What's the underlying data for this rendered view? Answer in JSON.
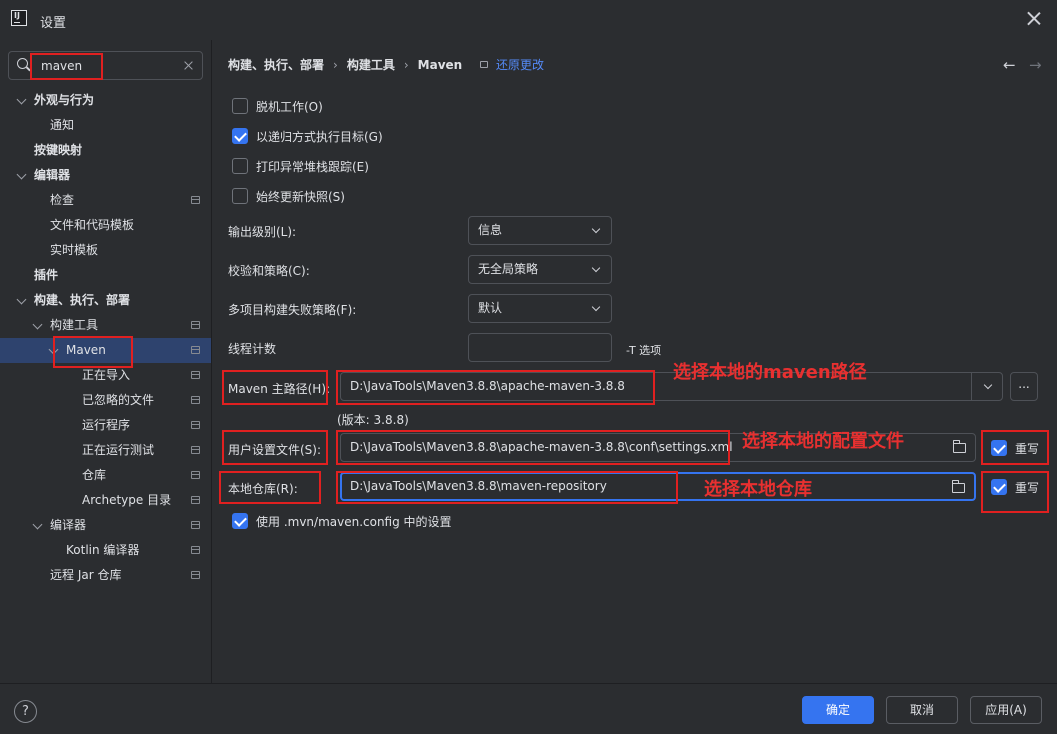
{
  "window": {
    "title": "设置"
  },
  "search": {
    "value": "maven",
    "placeholder": ""
  },
  "sidebar": {
    "items": [
      {
        "label": "外观与行为",
        "level": 0,
        "expanded": true,
        "bold": true
      },
      {
        "label": "通知",
        "level": 1
      },
      {
        "label": "按键映射",
        "level": 0,
        "bold": true
      },
      {
        "label": "编辑器",
        "level": 0,
        "expanded": true,
        "bold": true
      },
      {
        "label": "检查",
        "level": 1,
        "project_icon": true
      },
      {
        "label": "文件和代码模板",
        "level": 1
      },
      {
        "label": "实时模板",
        "level": 1
      },
      {
        "label": "插件",
        "level": 0,
        "bold": true
      },
      {
        "label": "构建、执行、部署",
        "level": 0,
        "expanded": true,
        "bold": true
      },
      {
        "label": "构建工具",
        "level": 1,
        "expanded": true,
        "project_icon": true
      },
      {
        "label": "Maven",
        "level": 2,
        "expanded": true,
        "selected": true,
        "project_icon": true
      },
      {
        "label": "正在导入",
        "level": 3,
        "project_icon": true
      },
      {
        "label": "已忽略的文件",
        "level": 3,
        "project_icon": true
      },
      {
        "label": "运行程序",
        "level": 3,
        "project_icon": true
      },
      {
        "label": "正在运行测试",
        "level": 3,
        "project_icon": true
      },
      {
        "label": "仓库",
        "level": 3,
        "project_icon": true
      },
      {
        "label": "Archetype 目录",
        "level": 3,
        "project_icon": true
      },
      {
        "label": "编译器",
        "level": 1,
        "expanded": true,
        "project_icon": true
      },
      {
        "label": "Kotlin 编译器",
        "level": 2,
        "project_icon": true
      },
      {
        "label": "远程 Jar 仓库",
        "level": 1,
        "project_icon": true
      }
    ]
  },
  "breadcrumb": {
    "part1": "构建、执行、部署",
    "part2": "构建工具",
    "part3": "Maven",
    "separator": "›"
  },
  "revert_label": "还原更改",
  "nav": {
    "back": "←",
    "forward": "→"
  },
  "options": {
    "offline": {
      "label": "脱机工作(O)",
      "checked": false
    },
    "recursive": {
      "label": "以递归方式执行目标(G)",
      "checked": true
    },
    "stacktrace": {
      "label": "打印异常堆栈跟踪(E)",
      "checked": false
    },
    "update_snapshots": {
      "label": "始终更新快照(S)",
      "checked": false
    }
  },
  "fields": {
    "output_level": {
      "label": "输出级别(L):",
      "value": "信息"
    },
    "checksum_policy": {
      "label": "校验和策略(C):",
      "value": "无全局策略"
    },
    "multiproject_fail": {
      "label": "多项目构建失败策略(F):",
      "value": "默认"
    },
    "thread_count": {
      "label": "线程计数",
      "value": "",
      "hint": "-T 选项"
    },
    "maven_home": {
      "label": "Maven 主路径(H):",
      "value": "D:\\JavaTools\\Maven3.8.8\\apache-maven-3.8.8",
      "version": "(版本: 3.8.8)",
      "browse": "..."
    },
    "user_settings": {
      "label": "用户设置文件(S):",
      "value": "D:\\JavaTools\\Maven3.8.8\\apache-maven-3.8.8\\conf\\settings.xml",
      "override_label": "重写",
      "override_checked": true
    },
    "local_repo": {
      "label": "本地仓库(R):",
      "value": "D:\\JavaTools\\Maven3.8.8\\maven-repository",
      "override_label": "重写",
      "override_checked": true
    }
  },
  "use_mvn_config": {
    "label": "使用 .mvn/maven.config 中的设置",
    "checked": true
  },
  "annotations": {
    "maven_home": "选择本地的maven路径",
    "settings": "选择本地的配置文件",
    "repo": "选择本地仓库"
  },
  "footer": {
    "help": "?",
    "ok": "确定",
    "cancel": "取消",
    "apply": "应用(A)"
  },
  "colors": {
    "background": "#2b2d30",
    "accent": "#3574f0",
    "link": "#548af7",
    "selection": "#2e436e",
    "annotation": "#e02020"
  }
}
